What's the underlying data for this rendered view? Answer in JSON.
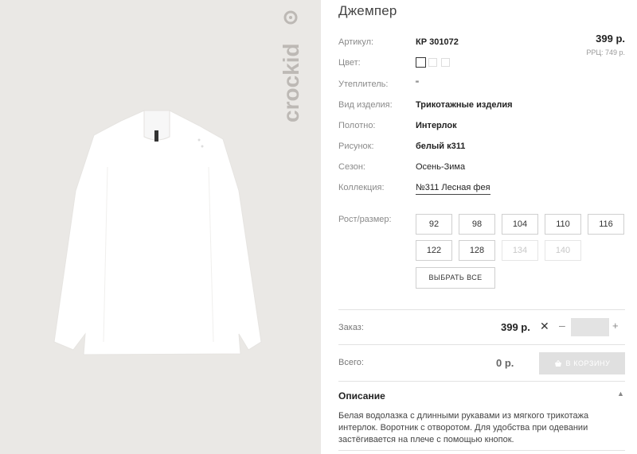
{
  "brand": {
    "logo_text": "crockid",
    "logo_icon": "crockid-logo-icon"
  },
  "product": {
    "title": "Джемпер",
    "image_icon": "turtleneck-icon"
  },
  "attributes": {
    "article": {
      "label": "Артикул:",
      "value": "КР 301072"
    },
    "color": {
      "label": "Цвет:"
    },
    "insulation": {
      "label": "Утеплитель:",
      "value": "\""
    },
    "type": {
      "label": "Вид изделия:",
      "value": "Трикотажные изделия"
    },
    "fabric": {
      "label": "Полотно:",
      "value": "Интерлок"
    },
    "pattern": {
      "label": "Рисунок:",
      "value": "белый к311"
    },
    "season": {
      "label": "Сезон:",
      "value": "Осень-Зима"
    },
    "collection": {
      "label": "Коллекция:",
      "value": "№311 Лесная фея"
    }
  },
  "price": {
    "main": "399 р.",
    "rrp": "РРЦ: 749 р."
  },
  "sizes": {
    "label": "Рост/размер:",
    "options": [
      {
        "label": "92",
        "available": true
      },
      {
        "label": "98",
        "available": true
      },
      {
        "label": "104",
        "available": true
      },
      {
        "label": "110",
        "available": true
      },
      {
        "label": "116",
        "available": true
      },
      {
        "label": "122",
        "available": true
      },
      {
        "label": "128",
        "available": true
      },
      {
        "label": "134",
        "available": false
      },
      {
        "label": "140",
        "available": false
      }
    ],
    "select_all_label": "ВЫБРАТЬ ВСЕ"
  },
  "order": {
    "label": "Заказ:",
    "price": "399 р.",
    "times_symbol": "✕",
    "minus": "–",
    "plus": "+",
    "quantity": ""
  },
  "total": {
    "label": "Всего:",
    "value": "0 р."
  },
  "cart_button": {
    "label": "В КОРЗИНУ",
    "icon": "cart-icon"
  },
  "description": {
    "title": "Описание",
    "collapse_icon": "▲",
    "text": "Белая водолазка с длинными рукавами из мягкого трикотажа интерлок. Воротник с отворотом. Для удобства при одевании застёгивается на плече с помощью кнопок."
  },
  "colors": {
    "panel_bg": "#eae8e5",
    "product_fill": "#ffffff",
    "divider": "#e2e2e2"
  }
}
